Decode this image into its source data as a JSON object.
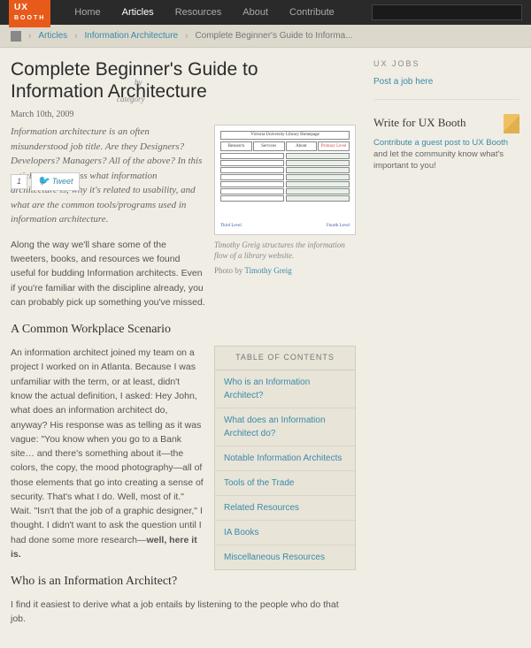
{
  "nav": {
    "logo": "UX",
    "logo_sub": "BOOTH",
    "items": [
      "Home",
      "Articles",
      "Resources",
      "About",
      "Contribute"
    ],
    "search_placeholder": " "
  },
  "breadcrumb": {
    "items": [
      "Articles",
      "Information Architecture"
    ],
    "current": "Complete Beginner's Guide to Informa..."
  },
  "article": {
    "title": "Complete Beginner's Guide to Information Architecture",
    "by_label": "by",
    "cat_label": "category",
    "date": "March 10th, 2009",
    "btn_1": "1",
    "tweet": "Tweet",
    "intro": "Information architecture is an often misunderstood job title. Are they Designers? Developers? Managers? All of the above? In this article we'll discuss what information architecture is, why it's related to usability, and what are the common tools/programs used in information architecture.",
    "fig_caption": "Timothy Greig structures the information flow of a library website.",
    "photo_by": "Photo by",
    "photo_author": "Timothy Greig",
    "fig_title": "Victoria University Library Homepage",
    "fig_tabs": [
      "Research",
      "Services",
      "About",
      "Primary Level"
    ],
    "fig_bottom": [
      "Third Level",
      "Fourth Level"
    ],
    "p1": "Along the way we'll share some of the tweeters, books, and resources we found useful for budding Information architects. Even if you're familiar with the discipline already, you can probably pick up something you've missed.",
    "h2_1": "A Common Workplace Scenario",
    "p2a": "An information architect joined my team on a project I worked on in Atlanta. Because I was unfamiliar with the term, or at least, didn't know the actual definition, I asked: Hey John, what does an information architect do, anyway? His response was as telling as it was vague: \"You know when you go to a Bank site… and there's something about it—the colors, the copy, the mood photography—all of those elements that go into creating a sense of security. That's what I do. Well, most of it.\" Wait. \"Isn't that the job of a graphic designer,\" I thought. I didn't want to ask the question until I had done some more research—",
    "p2b": "well, here it is.",
    "h2_2": "Who is an Information Architect?",
    "p3": "I find it easiest to derive what a job entails by listening to the people who do that job."
  },
  "toc": {
    "head": "TABLE OF CONTENTS",
    "items": [
      "Who is an Information Architect?",
      "What does an Information Architect do?",
      "Notable Information Architects",
      "Tools of the Trade",
      "Related Resources",
      "IA Books",
      "Miscellaneous Resources"
    ]
  },
  "sidebar": {
    "jobs_head": "UX JOBS",
    "jobs_link": "Post a job here",
    "write_head": "Write for UX Booth",
    "write_text1": "Contribute a guest post to UX Booth",
    "write_text2": " and let the community know what's important to you!"
  }
}
